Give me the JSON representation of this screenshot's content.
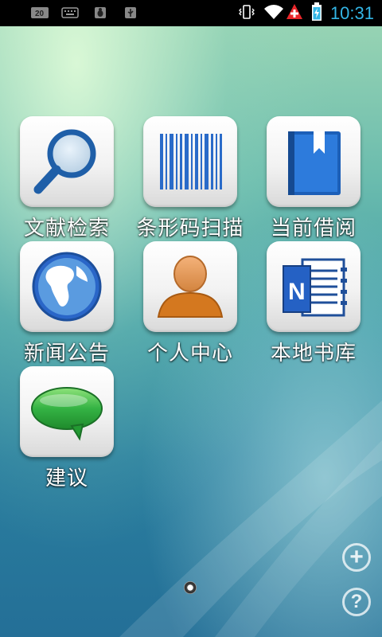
{
  "status_bar": {
    "time": "10:31",
    "left_icons": [
      "sd-card-icon",
      "keyboard-icon",
      "bug-debug-icon",
      "usb-icon"
    ],
    "right_icons": [
      "vibrate-icon",
      "wifi-icon",
      "alert-plus-icon",
      "battery-charging-icon"
    ],
    "clock_color": "#33b5e5"
  },
  "apps": [
    {
      "label": "文献检索",
      "icon": "magnifier-icon"
    },
    {
      "label": "条形码扫描",
      "icon": "barcode-icon"
    },
    {
      "label": "当前借阅",
      "icon": "book-bookmark-icon"
    },
    {
      "label": "新闻公告",
      "icon": "globe-icon"
    },
    {
      "label": "个人中心",
      "icon": "person-icon"
    },
    {
      "label": "本地书库",
      "icon": "notebook-n-icon"
    },
    {
      "label": "建议",
      "icon": "speech-bubble-icon"
    }
  ],
  "dock": {
    "add_symbol": "+",
    "help_symbol": "?"
  }
}
